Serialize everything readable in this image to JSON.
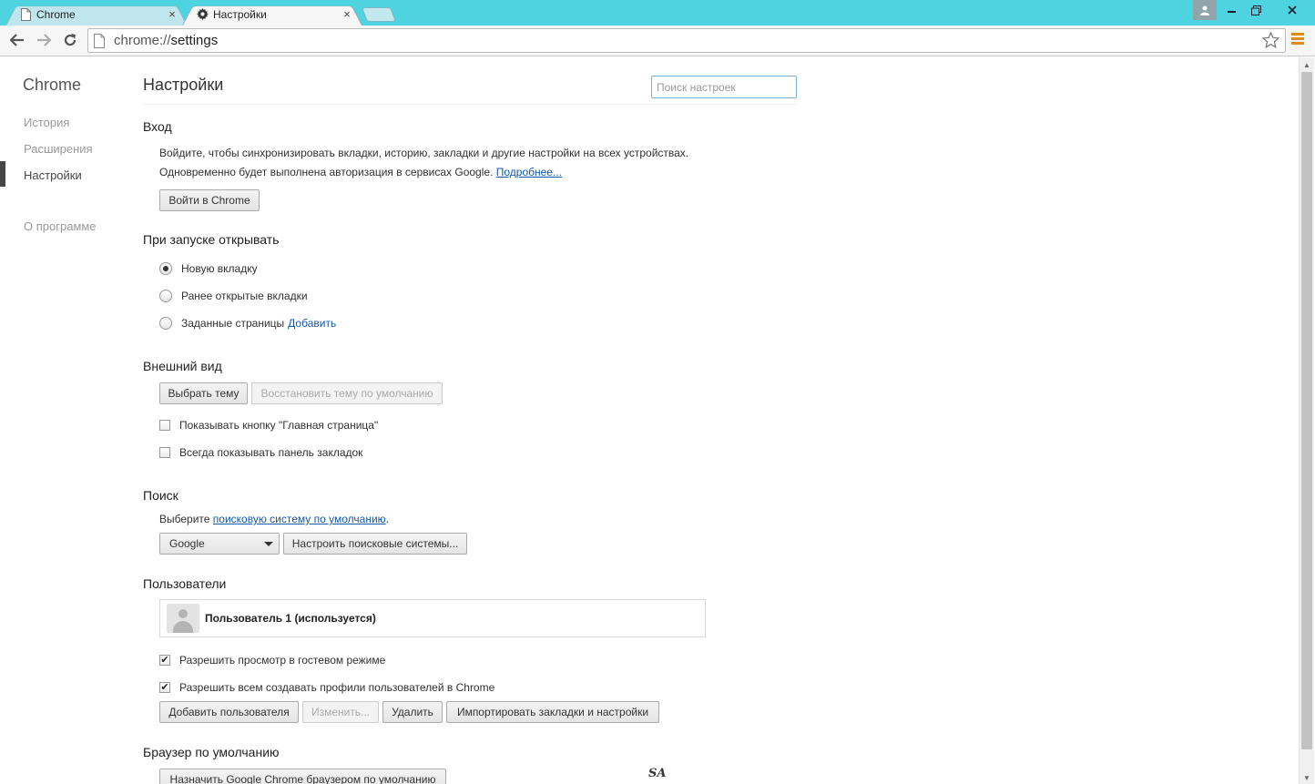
{
  "browser": {
    "tabs": [
      {
        "label": "Chrome",
        "icon": "page-icon",
        "active": false
      },
      {
        "label": "Настройки",
        "icon": "gear-icon",
        "active": true
      }
    ],
    "close_glyph": "×",
    "url_scheme": "chrome://",
    "url_path": "settings"
  },
  "sidebar": {
    "brand": "Chrome",
    "items": [
      {
        "label": "История",
        "current": false
      },
      {
        "label": "Расширения",
        "current": false
      },
      {
        "label": "Настройки",
        "current": true
      },
      {
        "label": "О программе",
        "current": false
      }
    ]
  },
  "page": {
    "title": "Настройки",
    "search_placeholder": "Поиск настроек"
  },
  "signin": {
    "title": "Вход",
    "line1": "Войдите, чтобы синхронизировать вкладки, историю, закладки и другие настройки на всех устройствах.",
    "line2": "Одновременно будет выполнена авторизация в сервисах Google.",
    "more_link": "Подробнее...",
    "button": "Войти в Chrome"
  },
  "startup": {
    "title": "При запуске открывать",
    "options": [
      {
        "label": "Новую вкладку",
        "selected": true
      },
      {
        "label": "Ранее открытые вкладки",
        "selected": false
      },
      {
        "label": "Заданные страницы",
        "selected": false
      }
    ],
    "add_link": "Добавить"
  },
  "appearance": {
    "title": "Внешний вид",
    "theme_button": "Выбрать тему",
    "reset_theme_button": "Восстановить тему по умолчанию",
    "show_home": {
      "label": "Показывать кнопку \"Главная страница\"",
      "checked": false
    },
    "show_bookmarks": {
      "label": "Всегда показывать панель закладок",
      "checked": false
    }
  },
  "search": {
    "title": "Поиск",
    "text_before": "Выберите",
    "link": "поисковую систему по умолчанию",
    "text_after": ".",
    "engine": "Google",
    "manage_button": "Настроить поисковые системы..."
  },
  "users": {
    "title": "Пользователи",
    "current_user": "Пользователь 1 (используется)",
    "guest": {
      "label": "Разрешить просмотр в гостевом режиме",
      "checked": true
    },
    "profiles": {
      "label": "Разрешить всем создавать профили пользователей в Chrome",
      "checked": true
    },
    "check_glyph": "✔",
    "buttons": {
      "add": "Добавить пользователя",
      "edit": "Изменить...",
      "delete": "Удалить",
      "import": "Импортировать закладки и настройки"
    }
  },
  "default_browser": {
    "title": "Браузер по умолчанию",
    "button": "Назначить Google Chrome браузером по умолчанию"
  },
  "watermark": "SA",
  "colors": {
    "titlebar": "#4ed3e1",
    "link": "#1558a8",
    "menu_accent": "#e08a1e"
  }
}
